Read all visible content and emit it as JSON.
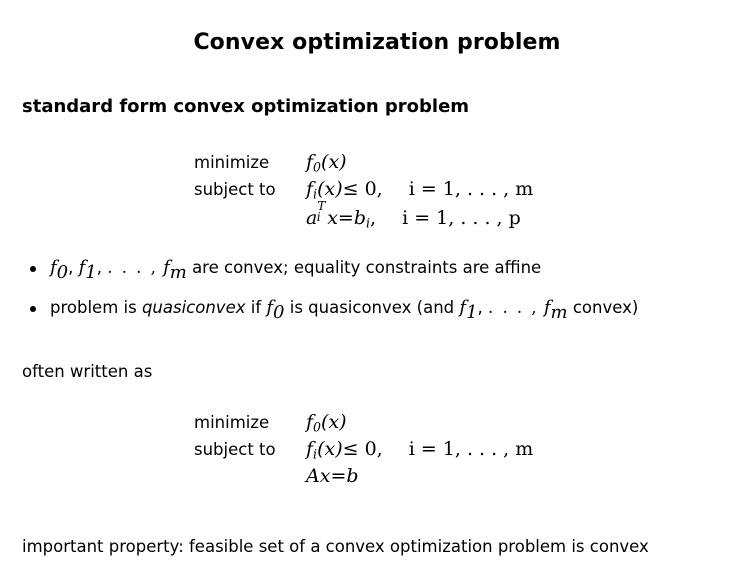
{
  "slide": {
    "title": "Convex optimization problem",
    "section_heading": "standard form convex optimization problem",
    "often_written_as": "often written as",
    "important_property": "important property: feasible set of a convex optimization problem is convex",
    "background_color": "#ffffff",
    "text_color": "#000000"
  },
  "problem_standard": {
    "minimize_label": "minimize",
    "subject_to_label": "subject to",
    "objective": "f0(x)",
    "objective_parts": {
      "fn": "f",
      "index": "0",
      "arg": "(x)"
    },
    "inequality_constraint": {
      "fn": "f",
      "index": "i",
      "arg": "(x)",
      "relation": "≤ 0,",
      "range": "i = 1, . . . , m"
    },
    "equality_constraint": {
      "vector": "a",
      "sub": "i",
      "sup": "T",
      "variable": "x",
      "relation": "=",
      "rhs": "b",
      "rhs_sub": "i",
      "trailing": ",",
      "range": "i = 1, . . . , p"
    }
  },
  "bullets": [
    {
      "segments": [
        {
          "text": "f",
          "style": "math"
        },
        {
          "text": "0",
          "style": "math-sub"
        },
        {
          "text": ", ",
          "style": "plain"
        },
        {
          "text": "f",
          "style": "math"
        },
        {
          "text": "1",
          "style": "math-sub"
        },
        {
          "text": ", . . . , ",
          "style": "plain"
        },
        {
          "text": "f",
          "style": "math"
        },
        {
          "text": "m",
          "style": "math-sub"
        },
        {
          "text": " are convex; equality constraints are affine",
          "style": "plain"
        }
      ],
      "plain_text": "f0, f1, . . . , fm are convex; equality constraints are affine"
    },
    {
      "segments": [
        {
          "text": "problem is ",
          "style": "plain"
        },
        {
          "text": "quasiconvex",
          "style": "italic"
        },
        {
          "text": " if ",
          "style": "plain"
        },
        {
          "text": "f",
          "style": "math"
        },
        {
          "text": "0",
          "style": "math-sub"
        },
        {
          "text": " is quasiconvex (and ",
          "style": "plain"
        },
        {
          "text": "f",
          "style": "math"
        },
        {
          "text": "1",
          "style": "math-sub"
        },
        {
          "text": ", . . . , ",
          "style": "plain"
        },
        {
          "text": "f",
          "style": "math"
        },
        {
          "text": "m",
          "style": "math-sub"
        },
        {
          "text": " convex)",
          "style": "plain"
        }
      ],
      "plain_text": "problem is quasiconvex if f0 is quasiconvex (and f1, . . . , fm convex)"
    }
  ],
  "problem_compact": {
    "minimize_label": "minimize",
    "subject_to_label": "subject to",
    "objective_parts": {
      "fn": "f",
      "index": "0",
      "arg": "(x)"
    },
    "inequality_constraint": {
      "fn": "f",
      "index": "i",
      "arg": "(x)",
      "relation": "≤ 0,",
      "range": "i = 1, . . . , m"
    },
    "equality_constraint": {
      "matrix": "A",
      "variable": "x",
      "relation": "=",
      "rhs": "b"
    }
  },
  "glyphs": {
    "bullet": "•",
    "leq": "≤",
    "ellipsis": ". . . ,"
  }
}
